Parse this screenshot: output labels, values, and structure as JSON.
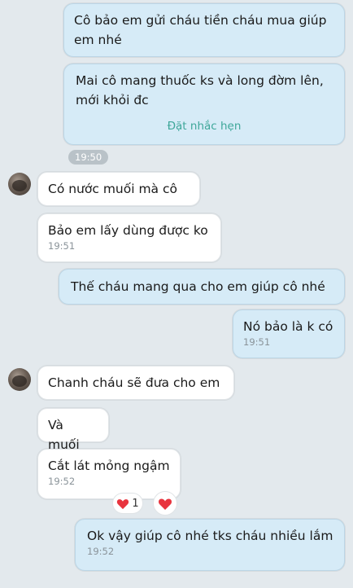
{
  "messages": {
    "m1": "Cô bảo em gửi cháu tiền cháu mua giúp em nhé",
    "m2": "Mai cô mang thuốc ks và long đờm lên, mới khỏi đc",
    "m2_action": "Đặt nhắc hẹn",
    "divider_time": "19:50",
    "m3": "Có nước muối mà cô",
    "m4": "Bảo em lấy dùng được ko",
    "m4_time": "19:51",
    "m5": "Thế cháu mang qua cho em giúp cô nhé",
    "m6": "Nó bảo là k có",
    "m6_time": "19:51",
    "m7": "Chanh cháu sẽ đưa cho em",
    "m8": "Và muối",
    "m9": "Cắt lát mỏng ngậm",
    "m9_time": "19:52",
    "m9_reaction_count": "1",
    "m10": "Ok vậy giúp cô nhé tks cháu nhiều lắm",
    "m10_time": "19:52"
  },
  "colors": {
    "background": "#e3e9ed",
    "sent_bubble": "#d6ebf7",
    "received_bubble": "#ffffff",
    "reminder_link": "#3fa79a",
    "heart": "#e8343e"
  },
  "icons": {
    "reaction": "heart-icon"
  }
}
